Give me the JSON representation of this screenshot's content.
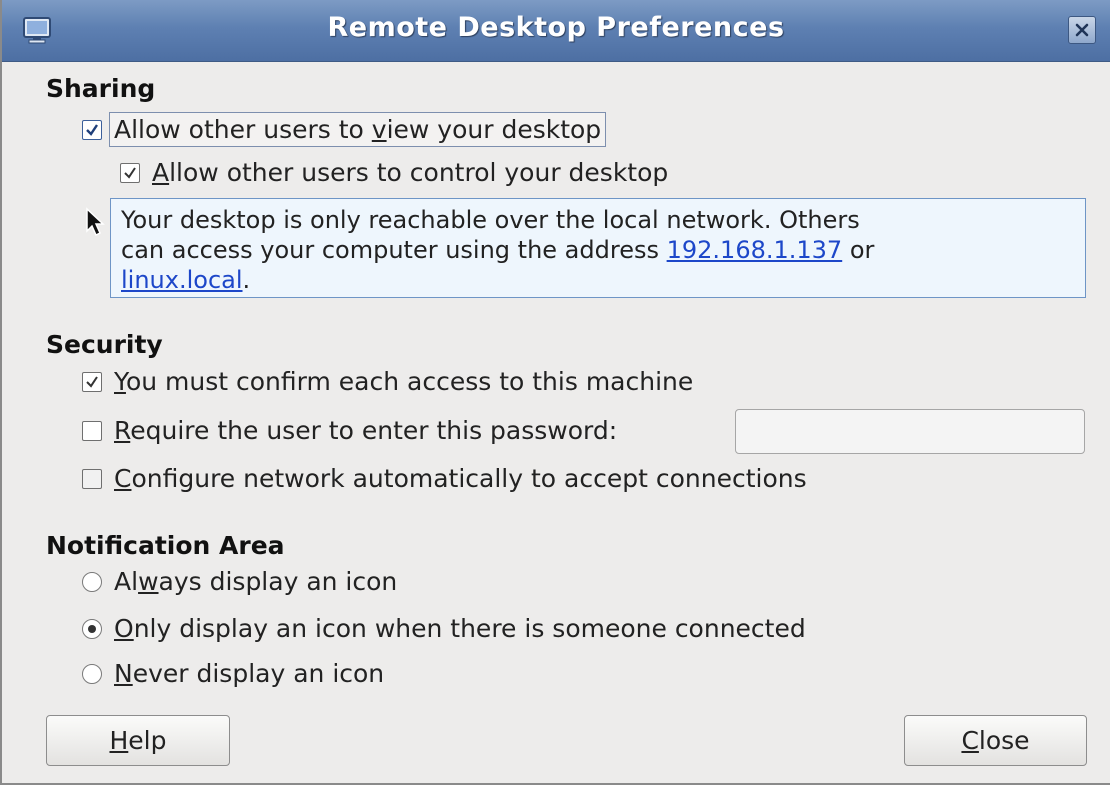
{
  "window": {
    "title": "Remote Desktop Preferences"
  },
  "sharing": {
    "heading": "Sharing",
    "allow_view": {
      "prefix": "Allow other users to ",
      "mnemonic": "v",
      "suffix": "iew your desktop",
      "checked": true
    },
    "allow_control": {
      "prefix": "",
      "mnemonic": "A",
      "suffix": "llow other users to control your desktop",
      "checked": true
    },
    "info": {
      "line1": "Your desktop is only reachable over the local network. Others",
      "line2_prefix": "can access your computer using the address ",
      "address_link": "192.168.1.137",
      "or_text": " or",
      "host_link": "linux.local",
      "end": "."
    }
  },
  "security": {
    "heading": "Security",
    "confirm": {
      "mnemonic": "Y",
      "suffix": "ou must confirm each access to this machine",
      "checked": true
    },
    "password": {
      "mnemonic": "R",
      "suffix": "equire the user to enter this password:",
      "checked": false,
      "value": ""
    },
    "network": {
      "mnemonic": "C",
      "suffix": "onfigure network automatically to accept connections",
      "checked": false
    }
  },
  "notification": {
    "heading": "Notification Area",
    "always": {
      "prefix": "Al",
      "mnemonic": "w",
      "suffix": "ays display an icon",
      "selected": false
    },
    "only": {
      "prefix": "",
      "mnemonic": "O",
      "suffix": "nly display an icon when there is someone connected",
      "selected": true
    },
    "never": {
      "prefix": "",
      "mnemonic": "N",
      "suffix": "ever display an icon",
      "selected": false
    }
  },
  "buttons": {
    "help": {
      "mnemonic": "H",
      "suffix": "elp"
    },
    "close": {
      "mnemonic": "C",
      "suffix": "lose"
    }
  },
  "colors": {
    "titlebar": "#5e80b2",
    "link": "#1d47c9",
    "info_bg": "#eef6fd"
  }
}
